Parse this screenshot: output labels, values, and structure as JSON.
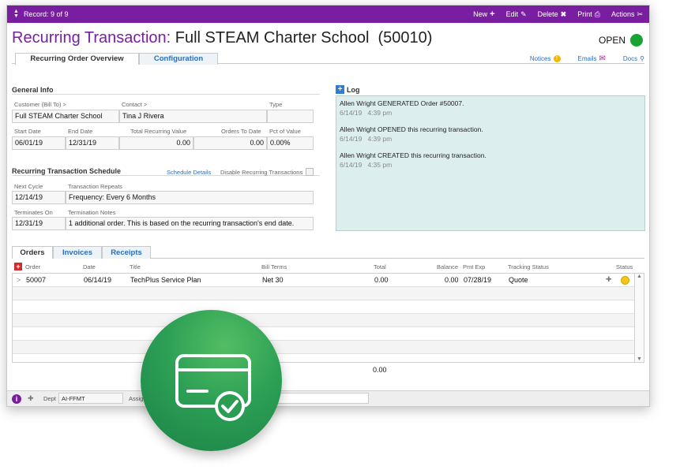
{
  "topbar": {
    "record_label": "Record: 9 of 9",
    "actions": [
      {
        "label": "New",
        "icon": "plus-icon"
      },
      {
        "label": "Edit",
        "icon": "pencil-icon"
      },
      {
        "label": "Delete",
        "icon": "x-icon"
      },
      {
        "label": "Print",
        "icon": "printer-icon"
      },
      {
        "label": "Actions",
        "icon": "wrench-icon"
      }
    ]
  },
  "header": {
    "kind": "Recurring Transaction:",
    "name": "Full STEAM Charter School  (50010)",
    "status": "OPEN",
    "status_color": "#18a332"
  },
  "tabs": [
    {
      "label": "Recurring Order Overview",
      "active": true
    },
    {
      "label": "Configuration",
      "active": false
    }
  ],
  "tab_links": {
    "notices": "Notices",
    "emails": "Emails",
    "docs": "Docs"
  },
  "general": {
    "title": "General Info",
    "customer_label": "Customer (Bill To) >",
    "customer": "Full STEAM Charter School",
    "contact_label": "Contact >",
    "contact": "Tina J Rivera",
    "type_label": "Type",
    "type": "",
    "start_label": "Start Date",
    "start": "06/01/19",
    "end_label": "End Date",
    "end": "12/31/19",
    "total_label": "Total Recurring Value",
    "total": "0.00",
    "orders_label": "Orders To Date",
    "orders": "0.00",
    "pct_label": "Pct of Value",
    "pct": "0.00%"
  },
  "schedule": {
    "title": "Recurring Transaction Schedule",
    "details_link": "Schedule Details",
    "disable_label": "Disable Recurring Transactions",
    "next_label": "Next Cycle",
    "next": "12/14/19",
    "repeats_label": "Transaction Repeats",
    "repeats": "Frequency: Every 6 Months",
    "terminates_label": "Terminates On",
    "terminates": "12/31/19",
    "termination_notes_label": "Termination Notes",
    "termination_notes": "1 additional order. This is based on the recurring transaction's end date."
  },
  "log": {
    "title": "Log",
    "entries": [
      {
        "text": "Allen Wright GENERATED Order #50007.",
        "time": "6/14/19   4:39 pm"
      },
      {
        "text": "Allen Wright OPENED this recurring transaction.",
        "time": "6/14/19   4:39 pm"
      },
      {
        "text": "Allen Wright CREATED this recurring transaction.",
        "time": "6/14/19   4:35 pm"
      }
    ]
  },
  "bottom_tabs": [
    {
      "label": "Orders",
      "active": true
    },
    {
      "label": "Invoices",
      "active": false
    },
    {
      "label": "Receipts",
      "active": false
    }
  ],
  "grid": {
    "columns": [
      "Order",
      "Date",
      "Title",
      "Bill Terms",
      "Total",
      "Balance",
      "Pmt Exp",
      "Tracking Status",
      "Status"
    ],
    "rows": [
      {
        "order": "50007",
        "date": "06/14/19",
        "title": "TechPlus Service Plan",
        "terms": "Net 30",
        "total": "0.00",
        "balance": "0.00",
        "pmt_exp": "07/28/19",
        "tracking": "Quote",
        "status_color": "#f5c518"
      }
    ],
    "sum_total": "0.00"
  },
  "footer": {
    "dept_label": "Dept",
    "dept_value": "AI-FFMT",
    "assign_label": "Assig"
  },
  "badge": {
    "icon": "credit-card-check-icon",
    "color": "#2c9f55"
  }
}
